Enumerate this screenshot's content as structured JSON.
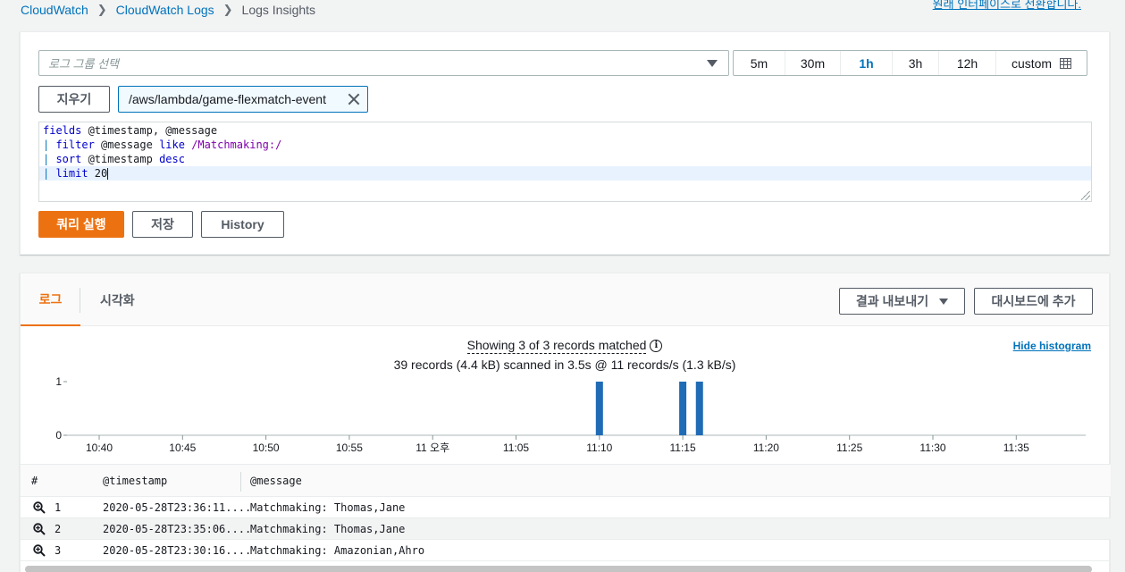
{
  "breadcrumb": {
    "items": [
      "CloudWatch",
      "CloudWatch Logs"
    ],
    "current": "Logs Insights"
  },
  "top_note": "원래 인터페이스로 전환합니다.",
  "query": {
    "log_group_placeholder": "로그 그룹 선택",
    "time_ranges": [
      "5m",
      "30m",
      "1h",
      "3h",
      "12h",
      "custom"
    ],
    "active_time_range": "1h",
    "clear_label": "지우기",
    "selected_log_group": "/aws/lambda/game-flexmatch-event",
    "lines": [
      [
        {
          "t": "fields",
          "c": "kw"
        },
        {
          "t": " @timestamp, @message",
          "c": ""
        }
      ],
      [
        {
          "t": "| ",
          "c": "pipe"
        },
        {
          "t": "filter",
          "c": "kw"
        },
        {
          "t": " @message ",
          "c": ""
        },
        {
          "t": "like",
          "c": "kw"
        },
        {
          "t": " ",
          "c": ""
        },
        {
          "t": "/Matchmaking:/",
          "c": "rx"
        }
      ],
      [
        {
          "t": "| ",
          "c": "pipe"
        },
        {
          "t": "sort",
          "c": "kw"
        },
        {
          "t": " @timestamp ",
          "c": ""
        },
        {
          "t": "desc",
          "c": "kw"
        }
      ],
      [
        {
          "t": "| ",
          "c": "pipe"
        },
        {
          "t": "limit",
          "c": "kw"
        },
        {
          "t": " 20",
          "c": ""
        }
      ]
    ],
    "run_label": "쿼리 실행",
    "save_label": "저장",
    "history_label": "History"
  },
  "results": {
    "tabs": [
      "로그",
      "시각화"
    ],
    "export_label": "결과 내보내기",
    "dashboard_label": "대시보드에 추가",
    "summary_matched": "Showing 3 of 3 records matched",
    "summary_scanned": "39 records (4.4 kB) scanned in 3.5s @ 11 records/s (1.3 kB/s)",
    "hide_histogram": "Hide histogram",
    "histogram": {
      "y_ticks": [
        "0",
        "1"
      ],
      "x_ticks": [
        "10:40",
        "10:45",
        "10:50",
        "10:55",
        "11 오후",
        "11:05",
        "11:10",
        "11:15",
        "11:20",
        "11:25",
        "11:30",
        "11:35"
      ],
      "bars_minutes": [
        30,
        35,
        36
      ],
      "bar_color": "#1f6bb5"
    },
    "columns": [
      "#",
      "@timestamp",
      "@message"
    ],
    "rows": [
      {
        "n": "1",
        "ts": "2020-05-28T23:36:11....",
        "msg": "Matchmaking: Thomas,Jane"
      },
      {
        "n": "2",
        "ts": "2020-05-28T23:35:06....",
        "msg": "Matchmaking: Thomas,Jane"
      },
      {
        "n": "3",
        "ts": "2020-05-28T23:30:16....",
        "msg": "Matchmaking: Amazonian,Ahro"
      }
    ]
  },
  "colors": {
    "accent": "#ec7211",
    "link": "#0073bb"
  }
}
